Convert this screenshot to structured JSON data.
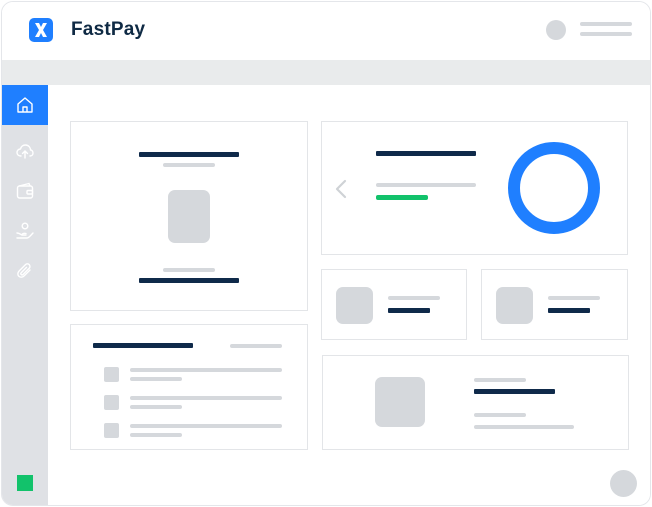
{
  "app": {
    "name": "FastPay",
    "logo_icon": "fastpay-logo-icon"
  },
  "colors": {
    "brand": "#1f7fff",
    "dark": "#0f2a4a",
    "skeleton": "#d5d8dc",
    "success": "#12c26b"
  },
  "sidebar": {
    "items": [
      {
        "icon": "home-icon",
        "active": true
      },
      {
        "icon": "upload-cloud-icon",
        "active": false
      },
      {
        "icon": "wallet-icon",
        "active": false
      },
      {
        "icon": "hand-coin-icon",
        "active": false
      },
      {
        "icon": "paperclip-icon",
        "active": false
      }
    ],
    "status_indicator": "status-square"
  },
  "header": {
    "avatar": "avatar-icon",
    "menu": "menu-lines-icon"
  }
}
